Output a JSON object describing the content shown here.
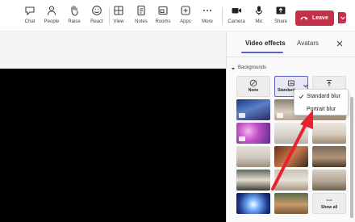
{
  "toolbar": {
    "chat": "Chat",
    "people": "People",
    "raise": "Raise",
    "react": "React",
    "view": "View",
    "notes": "Notes",
    "rooms": "Rooms",
    "apps": "Apps",
    "more": "More",
    "camera": "Camera",
    "mic": "Mic",
    "share": "Share",
    "leave": "Leave"
  },
  "panel": {
    "tabs": {
      "video_effects": "Video effects",
      "avatars": "Avatars"
    },
    "section": "Backgrounds",
    "tiles": {
      "none": "None",
      "standard": "Standard blur",
      "standard_short": "Standard",
      "show_all": "Show all"
    }
  },
  "dropdown": {
    "items": [
      "Standard blur",
      "Portrait blur"
    ],
    "checked_index": 0
  },
  "colors": {
    "accent": "#5b5fc7",
    "leave": "#c4314b",
    "arrow": "#e8222a"
  },
  "icons": {
    "chat": "chat-icon",
    "people": "people-icon",
    "raise": "hand-icon",
    "react": "smiley-icon",
    "view": "grid-icon",
    "notes": "notes-icon",
    "rooms": "rooms-icon",
    "apps": "plus-icon",
    "more": "ellipsis-icon",
    "camera": "camera-icon",
    "mic": "mic-icon",
    "share": "share-icon"
  }
}
